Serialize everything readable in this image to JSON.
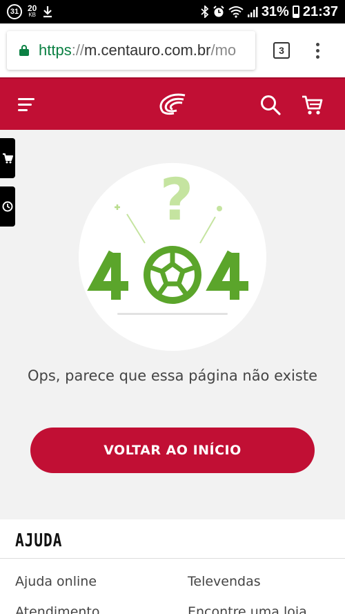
{
  "status_bar": {
    "notif_count": "31",
    "data_rate_value": "20",
    "data_rate_unit": "KB",
    "battery_pct": "31%",
    "time": "21:37"
  },
  "browser": {
    "url_scheme": "https",
    "url_sep": "://",
    "url_host": "m.centauro.com.br",
    "url_path": "/mo",
    "tab_count": "3"
  },
  "header": {
    "logo_name": "centauro-logo"
  },
  "error_page": {
    "illustration_text": "404",
    "question_mark": "?",
    "message": "Ops, parece que essa página não existe",
    "cta_label": "VOLTAR AO INÍCIO"
  },
  "footer": {
    "title": "AJUDA",
    "links": [
      "Ajuda online",
      "Televendas",
      "Atendimento",
      "Encontre uma loja"
    ]
  },
  "colors": {
    "brand": "#c10f34",
    "illustration_green": "#5ba52b",
    "illustration_light_green": "#b9dd8e"
  }
}
